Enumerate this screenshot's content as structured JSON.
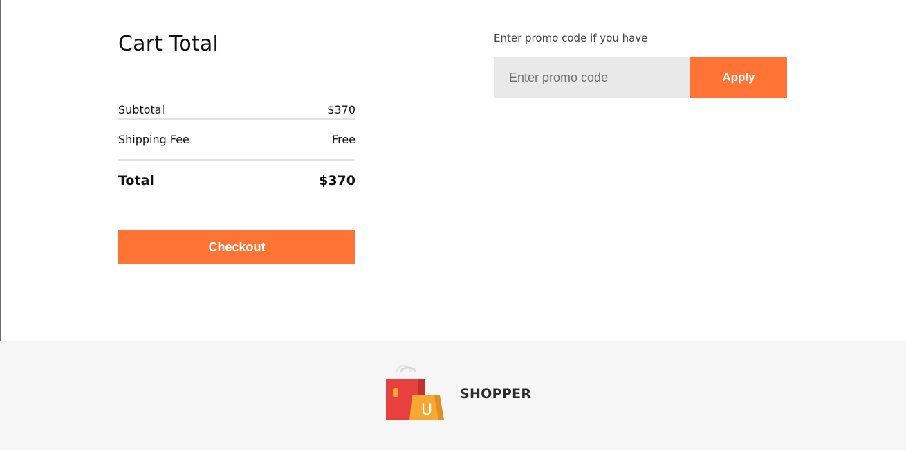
{
  "cart": {
    "title": "Cart Total",
    "rows": [
      {
        "label": "Subtotal",
        "value": "$370"
      },
      {
        "label": "Shipping Fee",
        "value": "Free"
      }
    ],
    "total": {
      "label": "Total",
      "value": "$370"
    },
    "checkout_label": "Checkout"
  },
  "promo": {
    "label": "Enter promo code if you have",
    "input_value": "",
    "placeholder": "Enter promo code",
    "apply_label": "Apply"
  },
  "footer": {
    "brand_name": "SHOPPER",
    "logo_icon": "shopping-bags-icon",
    "logo_letter": "U"
  },
  "colors": {
    "accent": "#ff7335",
    "input_bg": "#e9e9e9",
    "footer_bg": "#f6f6f6",
    "divider": "#e2e2e2"
  }
}
